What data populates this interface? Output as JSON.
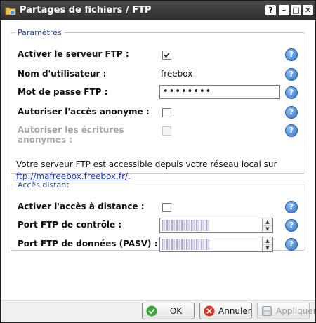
{
  "window": {
    "title": "Partages de fichiers / FTP",
    "help_glyph": "?",
    "minimize_glyph": "–",
    "maximize_glyph": "□",
    "close_glyph": "✕"
  },
  "parametres": {
    "legend": "Paramètres",
    "activer_ftp": {
      "label": "Activer le serveur FTP :",
      "checked": true
    },
    "nom_utilisateur": {
      "label": "Nom d'utilisateur :",
      "value": "freebox"
    },
    "mot_de_passe": {
      "label": "Mot de passe FTP :",
      "value": "••••••••"
    },
    "acces_anonyme": {
      "label": "Autoriser l'accès anonyme :",
      "checked": false
    },
    "ecritures_anonymes": {
      "label_line1": "Autoriser les écritures",
      "label_line2": "anonymes :",
      "checked": false,
      "disabled": true
    },
    "info_text": "Votre serveur FTP est accessible depuis votre réseau local sur",
    "info_link": "ftp://mafreebox.freebox.fr/",
    "info_suffix": "."
  },
  "acces_distant": {
    "legend": "Accès distant",
    "activer_distance": {
      "label": "Activer l'accès à distance :",
      "checked": false
    },
    "port_controle": {
      "label": "Port FTP de contrôle :"
    },
    "port_donnees": {
      "label": "Port FTP de données (PASV) :"
    }
  },
  "help_icon_glyph": "?",
  "spin_up_glyph": "▲",
  "spin_down_glyph": "▼",
  "footer": {
    "ok_label": "OK",
    "annuler_label": "Annuler",
    "appliquer_label": "Appliquer"
  },
  "colors": {
    "title_bar": "#3a3a3a",
    "link": "#1a3aa8",
    "help_icon": "#2f6fc4",
    "ok_icon": "#3aa53a",
    "cancel_icon": "#d03a2a",
    "disabled_text": "#a8a8a8"
  }
}
